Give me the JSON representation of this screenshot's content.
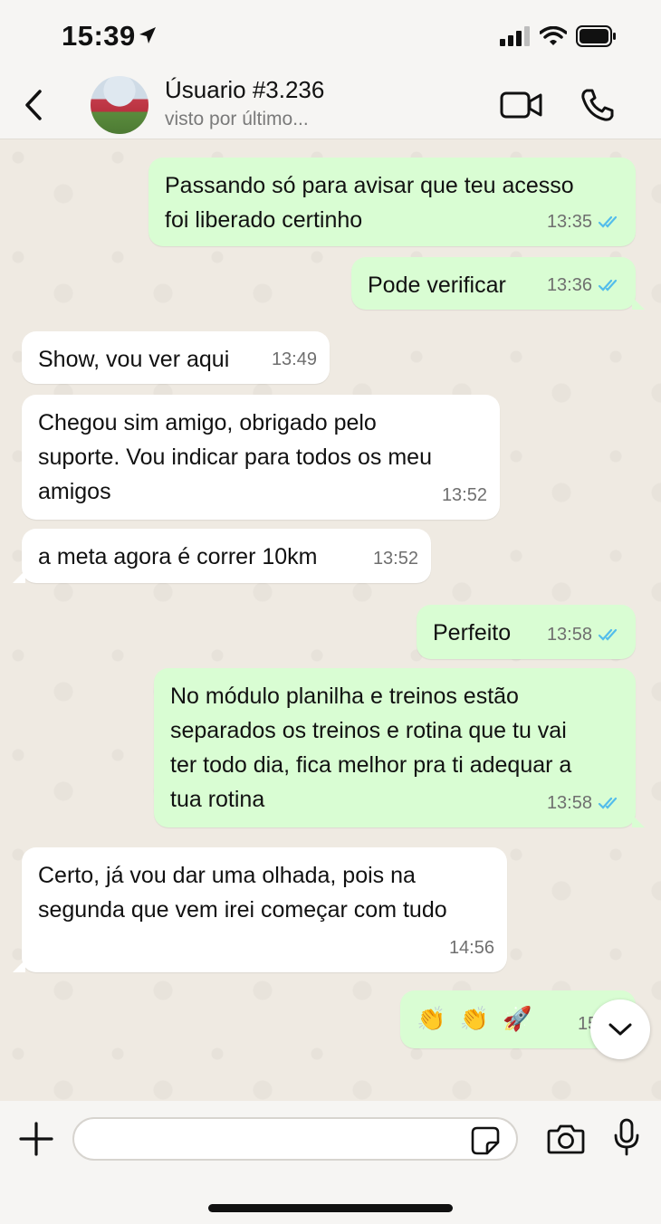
{
  "status_bar": {
    "time": "15:39"
  },
  "header": {
    "contact_name": "Úsuario #3.236",
    "contact_status": "visto por último..."
  },
  "messages": [
    {
      "direction": "out",
      "text": "Passando só para avisar que teu acesso\nfoi liberado certinho",
      "time": "13:35",
      "read": true
    },
    {
      "direction": "out",
      "text": "Pode verificar",
      "time": "13:36",
      "read": true
    },
    {
      "direction": "in",
      "text": "Show, vou ver aqui",
      "time": "13:49"
    },
    {
      "direction": "in",
      "text": "Chegou sim amigo, obrigado pelo\nsuporte. Vou indicar para todos os meu\namigos",
      "time": "13:52"
    },
    {
      "direction": "in",
      "text": "a meta agora é correr 10km",
      "time": "13:52"
    },
    {
      "direction": "out",
      "text": "Perfeito",
      "time": "13:58",
      "read": true
    },
    {
      "direction": "out",
      "text": "No módulo planilha e treinos estão\nseparados os treinos e rotina que tu vai\nter todo dia, fica melhor pra ti adequar a\ntua rotina",
      "time": "13:58",
      "read": true
    },
    {
      "direction": "in",
      "text": "Certo, já vou dar uma olhada, pois na\nsegunda que vem irei começar com tudo",
      "time": "14:56"
    },
    {
      "direction": "out",
      "text": "👏 👏 🚀",
      "time": "15:07",
      "read": true
    }
  ],
  "input": {
    "placeholder": ""
  },
  "colors": {
    "outgoing_bubble": "#d9fdd3",
    "incoming_bubble": "#ffffff",
    "read_ticks": "#53bdeb",
    "chat_background": "#efeae2"
  }
}
